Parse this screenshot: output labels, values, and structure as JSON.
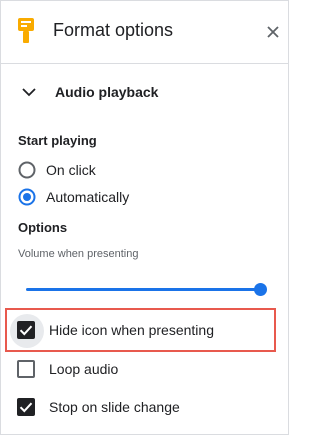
{
  "header": {
    "title": "Format options",
    "icon": "format-options-icon",
    "close_icon": "close-icon"
  },
  "section": {
    "title": "Audio playback",
    "expanded": true
  },
  "start_playing": {
    "heading": "Start playing",
    "options": [
      {
        "label": "On click",
        "selected": false
      },
      {
        "label": "Automatically",
        "selected": true
      }
    ]
  },
  "options": {
    "heading": "Options",
    "volume_label": "Volume when presenting",
    "volume_level": 1.0,
    "checkboxes": [
      {
        "label": "Hide icon when presenting",
        "checked": true,
        "highlighted": true
      },
      {
        "label": "Loop audio",
        "checked": false
      },
      {
        "label": "Stop on slide change",
        "checked": true
      }
    ]
  },
  "colors": {
    "accent": "#1a73e8",
    "highlight": "#e8594d",
    "icon_yellow": "#f9ab00"
  }
}
